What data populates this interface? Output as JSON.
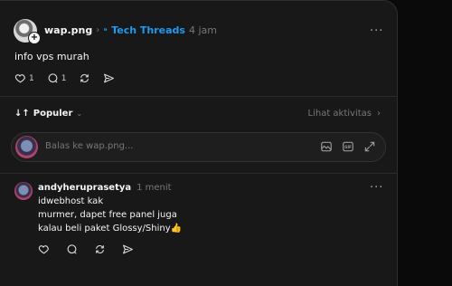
{
  "post": {
    "username": "wap.png",
    "topic": "Tech Threads",
    "time": "4 jam",
    "text": "info vps murah",
    "like_count": "1",
    "reply_count": "1"
  },
  "sort": {
    "label": "Populer",
    "activity_label": "Lihat aktivitas"
  },
  "reply": {
    "placeholder": "Balas ke wap.png..."
  },
  "comment": {
    "username": "andyheruprasetya",
    "time": "1 menit",
    "lines": [
      "idwebhost kak",
      "murmer, dapet free panel juga",
      "kalau beli paket Glossy/Shiny"
    ],
    "emoji": "👍"
  },
  "colors": {
    "topic": "#1d9bf0",
    "panel_bg": "#181818",
    "page_bg": "#0a0a0a"
  }
}
